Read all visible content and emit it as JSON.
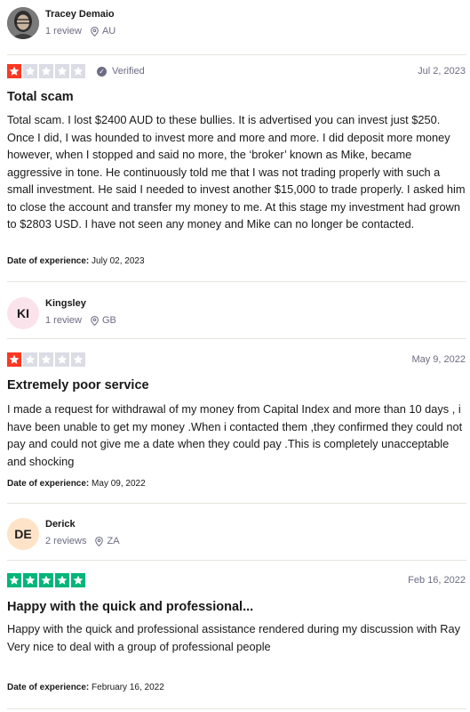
{
  "colors": {
    "star_red": "#ff3722",
    "star_green": "#00b67a",
    "star_empty": "#dcdce6",
    "muted_text": "#6c6c85",
    "avatar_ki": "#fbe3ec",
    "avatar_de": "#ffe3c9"
  },
  "reviews": [
    {
      "consumer": {
        "name": "Tracey Demaio",
        "avatar": "photo",
        "reviews": "1 review",
        "country": "AU"
      },
      "rating": 1,
      "verified": "Verified",
      "date": "Jul 2, 2023",
      "title": "Total scam",
      "body": "Total scam. I lost $2400 AUD to these bullies. It is advertised you can invest just $250. Once I did, I was hounded to invest more and more and more. I did deposit more money however, when I stopped and said no more, the ‘broker’ known as Mike, became aggressive in tone. He continuously told me that I was not trading properly with such a small investment. He said I needed to invest another $15,000 to trade properly. I asked him to close the account and transfer my money to me. At this stage my investment had grown to $2803 USD. I have not seen any money and Mike can no longer be contacted.",
      "experience_label": "Date of experience:",
      "experience_date": "July 02, 2023"
    },
    {
      "consumer": {
        "name": "Kingsley",
        "avatar": "KI",
        "reviews": "1 review",
        "country": "GB"
      },
      "rating": 1,
      "date": "May 9, 2022",
      "title": "Extremely poor service",
      "body": "I made a request for withdrawal of my money from Capital Index and more than 10 days , i have been unable to get my money .When i contacted them ,they confirmed they could not pay and could not give me a date when they could pay .This is completely unacceptable and shocking",
      "experience_label": "Date of experience:",
      "experience_date": "May 09, 2022"
    },
    {
      "consumer": {
        "name": "Derick",
        "avatar": "DE",
        "reviews": "2 reviews",
        "country": "ZA"
      },
      "rating": 5,
      "date": "Feb 16, 2022",
      "title": "Happy with the quick and professional...",
      "body": "Happy with the quick and professional assistance rendered during my discussion with Ray\nVery nice to deal with a group of professional people",
      "experience_label": "Date of experience:",
      "experience_date": "February 16, 2022"
    }
  ]
}
